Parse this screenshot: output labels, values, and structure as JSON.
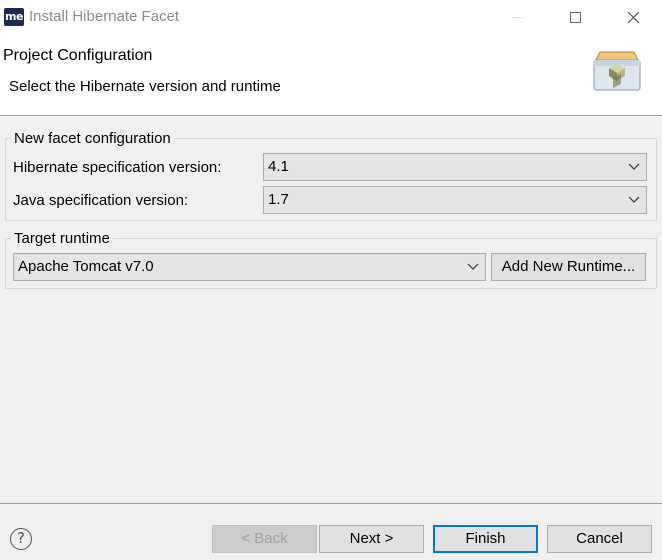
{
  "window": {
    "app_icon_text": "me",
    "title": "Install Hibernate Facet"
  },
  "banner": {
    "title": "Project Configuration",
    "subtitle": "Select the Hibernate version and runtime"
  },
  "facet_group": {
    "legend": "New facet configuration",
    "hibernate_label": "Hibernate specification version:",
    "hibernate_value": "4.1",
    "java_label": "Java specification version:",
    "java_value": "1.7"
  },
  "runtime_group": {
    "legend": "Target runtime",
    "runtime_value": "Apache Tomcat v7.0",
    "add_runtime_label": "Add New Runtime..."
  },
  "footer": {
    "help_glyph": "?",
    "back_label": "< Back",
    "next_label": "Next >",
    "finish_label": "Finish",
    "cancel_label": "Cancel"
  },
  "colors": {
    "default_button_border": "#0078d7",
    "dialog_background": "#f0f0f0"
  }
}
